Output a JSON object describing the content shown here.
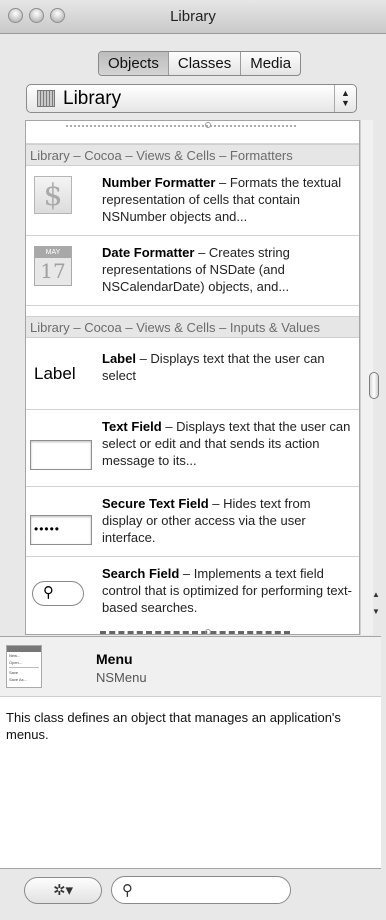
{
  "window": {
    "title": "Library"
  },
  "tabs": [
    {
      "label": "Objects",
      "selected": true
    },
    {
      "label": "Classes",
      "selected": false
    },
    {
      "label": "Media",
      "selected": false
    }
  ],
  "popup": {
    "selected": "Library",
    "icon": "library-icon"
  },
  "sections": [
    {
      "header": "Library – Cocoa – Views & Cells – Formatters"
    },
    {
      "header": "Library – Cocoa – Views & Cells – Inputs & Values"
    }
  ],
  "items": [
    {
      "name": "Number Formatter",
      "desc": " – Formats the textual representation of cells that contain NSNumber objects and...",
      "icon": "number-formatter-icon",
      "icon_text": "$"
    },
    {
      "name": "Date Formatter",
      "desc": " – Creates string representations of NSDate (and NSCalendarDate) objects, and...",
      "icon": "date-formatter-icon",
      "icon_month": "MAY",
      "icon_day": "17"
    },
    {
      "name": "Label",
      "desc": " – Displays text that the user can select",
      "icon": "label-icon",
      "icon_text": "Label"
    },
    {
      "name": "Text Field",
      "desc": " – Displays text that the user can select or edit and that sends its action message to its...",
      "icon": "text-field-icon"
    },
    {
      "name": "Secure Text Field",
      "desc": " – Hides text from display or other access via the user interface.",
      "icon": "secure-text-field-icon",
      "icon_text": "•••••"
    },
    {
      "name": "Search Field",
      "desc": " – Implements a text field control that is optimized for performing text-based searches.",
      "icon": "search-field-icon"
    }
  ],
  "detail": {
    "name": "Menu",
    "class_name": "NSMenu",
    "description": "This class defines an object that manages an application's menus.",
    "icon": "menu-icon",
    "icon_lines": [
      "New...",
      "Open...",
      "Save",
      "Save As..."
    ]
  },
  "bottom": {
    "gear_label": "✲▾",
    "search_value": "",
    "search_placeholder": ""
  }
}
